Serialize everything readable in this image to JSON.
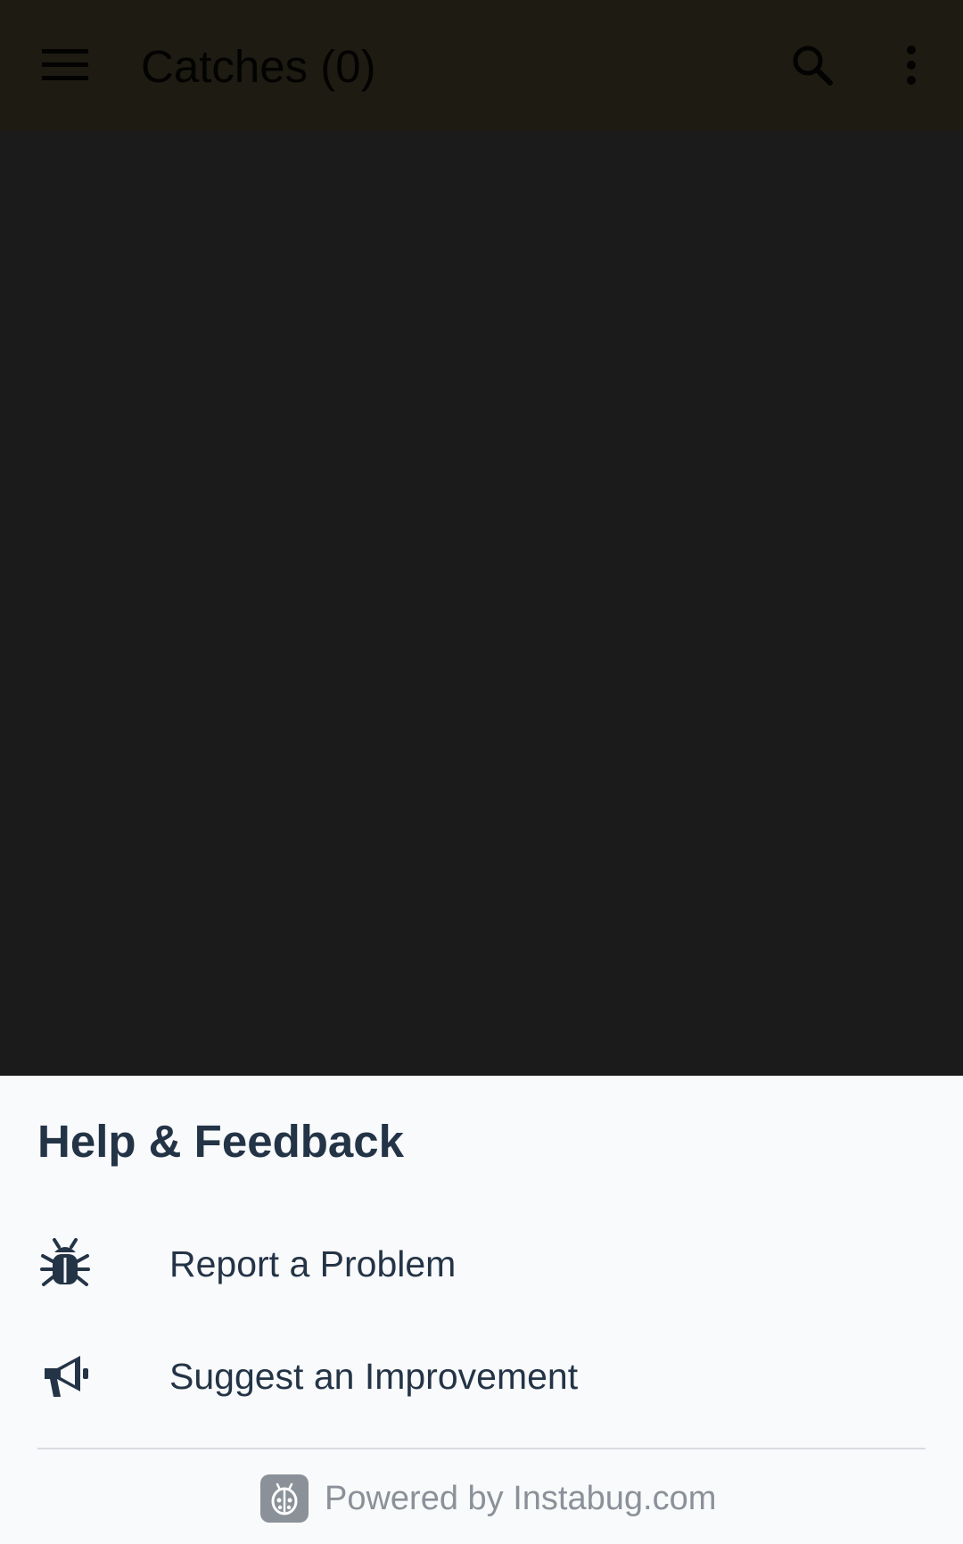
{
  "app_bar": {
    "title": "Catches (0)",
    "menu_icon": "hamburger-menu-icon",
    "search_icon": "search-icon",
    "overflow_icon": "more-vert-icon",
    "background": "#1e1b12"
  },
  "sheet": {
    "title": "Help & Feedback",
    "options": [
      {
        "label": "Report a Problem",
        "icon": "bug-icon"
      },
      {
        "label": "Suggest an Improvement",
        "icon": "megaphone-icon"
      }
    ],
    "footer": {
      "text": "Powered by Instabug.com",
      "logo_icon": "instabug-logo-icon"
    },
    "text_color": "#243447",
    "background": "#f9fafb"
  },
  "scrim_color": "#1b1b1c"
}
